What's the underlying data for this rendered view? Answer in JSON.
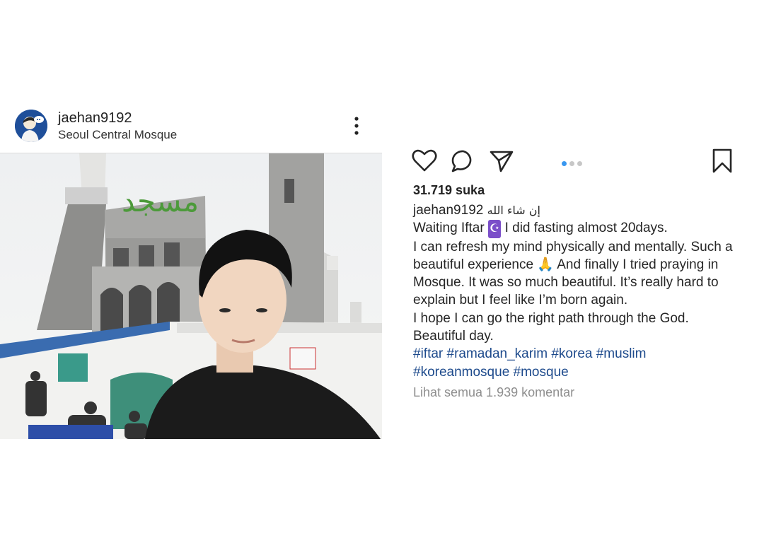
{
  "post": {
    "username": "jaehan9192",
    "location": "Seoul Central Mosque",
    "likes_text": "31.719 suka",
    "caption": {
      "username": "jaehan9192",
      "arabic": "إن شاء الله",
      "line1_a": "Waiting Iftar ",
      "emoji_moon": "☪",
      "line1_b": " I did fasting almost 20days.",
      "line2": "I can refresh my mind physically and mentally. Such a beautiful experience ",
      "emoji_pray": "🙏",
      "line2_b": " And finally I tried praying in Mosque. It was so much beautiful. It’s really hard to explain but I feel like I’m born again.",
      "line3": "I hope I can go the right path through the God.",
      "line4": "Beautiful day.",
      "hashtags": "#iftar #ramadan_karim #korea #muslim #koreanmosque #mosque"
    },
    "comments_link": "Lihat semua 1.939 komentar",
    "sign_text": "مسجد",
    "carousel": {
      "count": 3,
      "active_index": 0
    },
    "colors": {
      "accent_dot": "#3897f0",
      "hashtag": "#1d4a8c",
      "muted": "#8e8e8e"
    }
  }
}
